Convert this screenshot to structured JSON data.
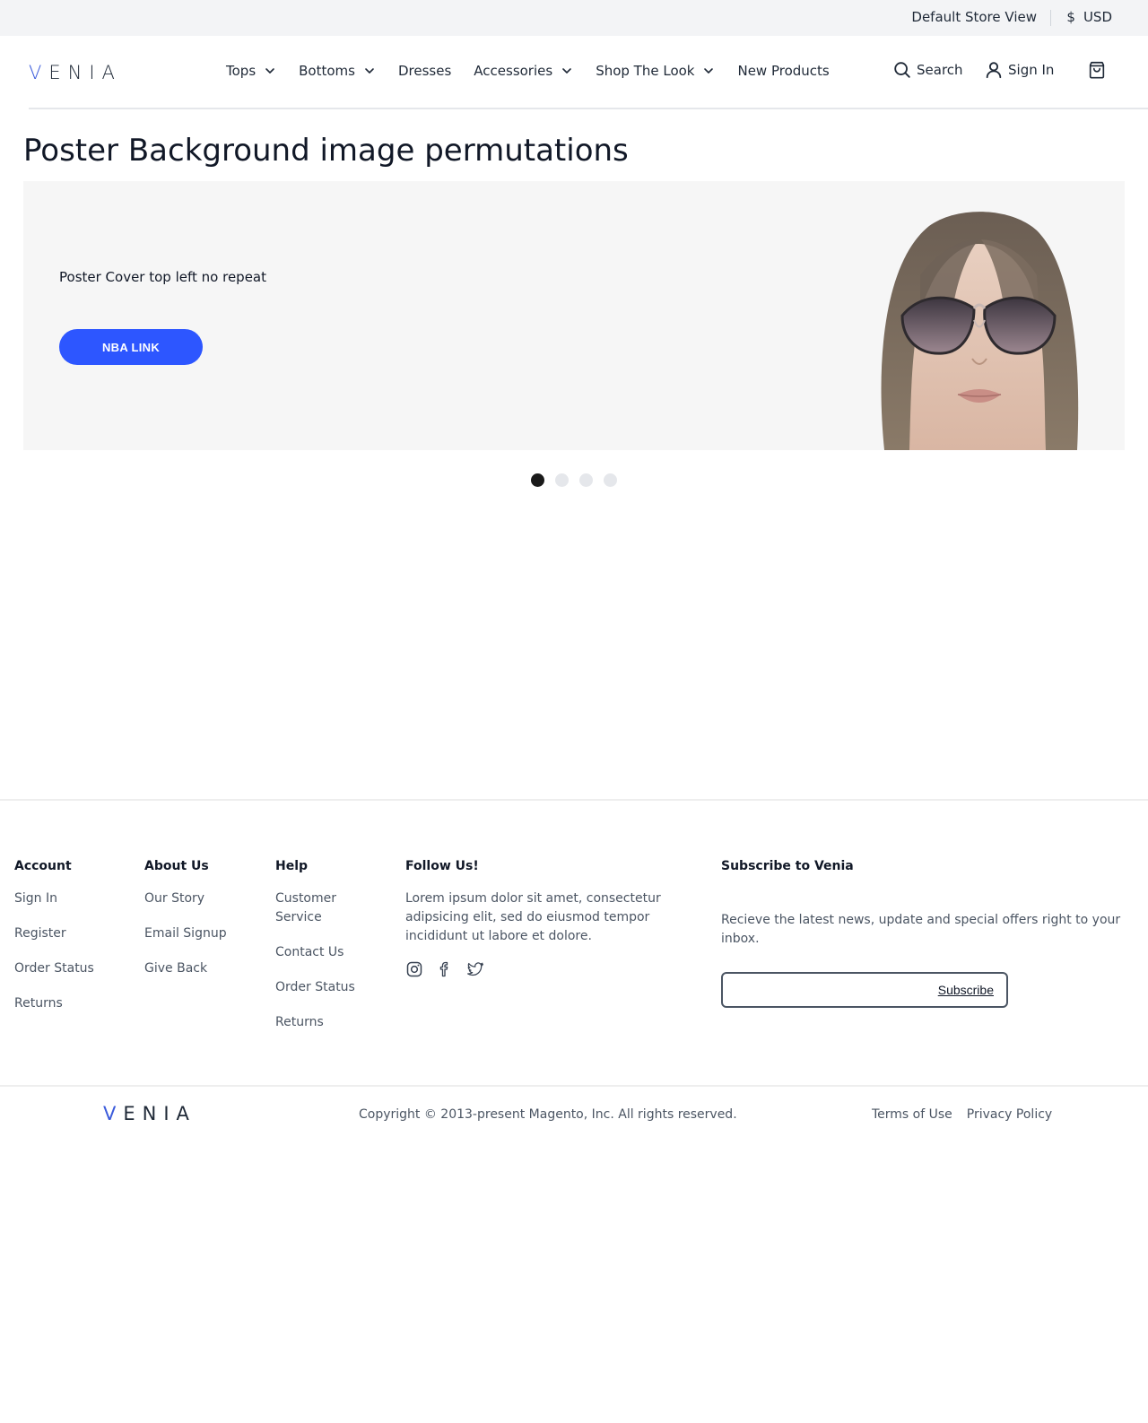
{
  "topbar": {
    "store_view": "Default Store View",
    "currency_symbol": "$",
    "currency": "USD"
  },
  "header": {
    "logo": "VENIA",
    "nav": [
      {
        "label": "Tops",
        "has_dropdown": true
      },
      {
        "label": "Bottoms",
        "has_dropdown": true
      },
      {
        "label": "Dresses",
        "has_dropdown": false
      },
      {
        "label": "Accessories",
        "has_dropdown": true
      },
      {
        "label": "Shop The Look",
        "has_dropdown": true
      },
      {
        "label": "New Products",
        "has_dropdown": false
      }
    ],
    "search_label": "Search",
    "signin_label": "Sign In",
    "icons": {
      "search": "search-icon",
      "account": "user-icon",
      "cart": "shopping-bag-icon"
    }
  },
  "main": {
    "title": "Poster Background image permutations",
    "banner": {
      "text": "Poster Cover top left no repeat",
      "button_label": "NBA LINK",
      "accent": "#2d56ff",
      "background": "#f6f6f6"
    },
    "carousel": {
      "count": 4,
      "active_index": 0
    }
  },
  "footer": {
    "account": {
      "heading": "Account",
      "links": [
        "Sign In",
        "Register",
        "Order Status",
        "Returns"
      ]
    },
    "about": {
      "heading": "About Us",
      "links": [
        "Our Story",
        "Email Signup",
        "Give Back"
      ]
    },
    "help": {
      "heading": "Help",
      "links": [
        "Customer Service",
        "Contact Us",
        "Order Status",
        "Returns"
      ]
    },
    "follow": {
      "heading": "Follow Us!",
      "text": "Lorem ipsum dolor sit amet, consectetur adipsicing elit, sed do eiusmod tempor incididunt ut labore et dolore.",
      "icons": [
        "instagram-icon",
        "facebook-icon",
        "twitter-icon"
      ]
    },
    "subscribe": {
      "heading": "Subscribe to Venia",
      "text": "Recieve the latest news, update and special offers right to your inbox.",
      "input_value": "",
      "button_label": "Subscribe"
    },
    "logo": "VENIA",
    "copyright": "Copyright © 2013-present Magento, Inc. All rights reserved.",
    "legal": [
      "Terms of Use",
      "Privacy Policy"
    ]
  }
}
